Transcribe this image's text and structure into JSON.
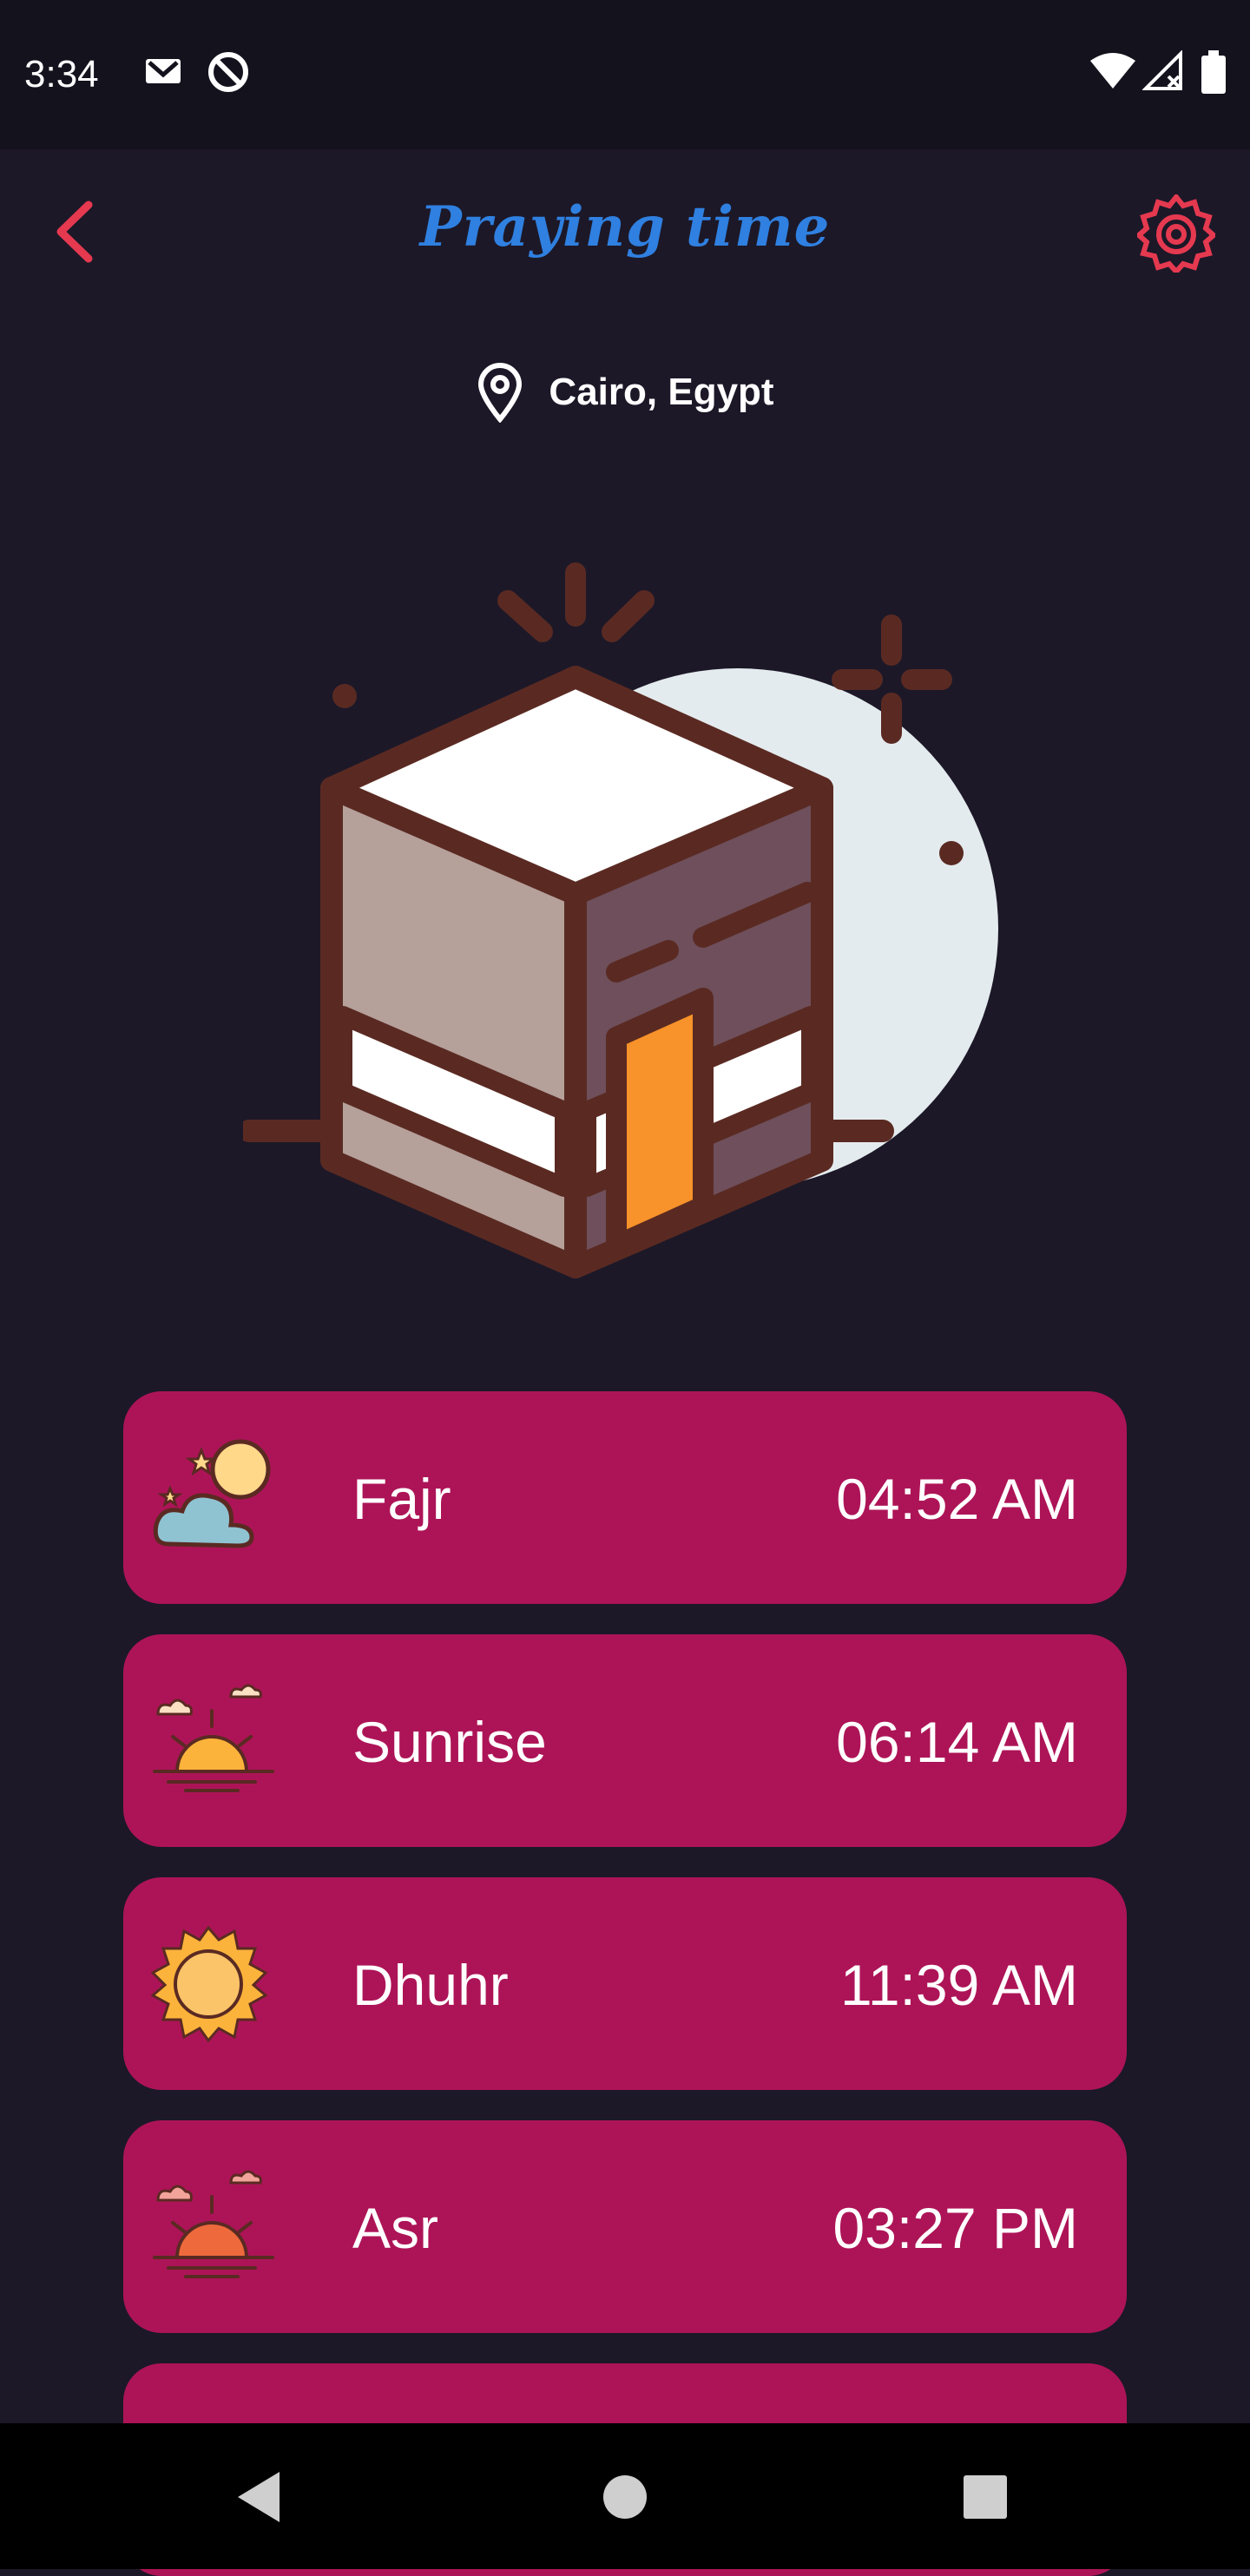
{
  "status_bar": {
    "time": "3:34",
    "icons": [
      "gmail-icon",
      "no-disturb-icon",
      "wifi-icon",
      "signal-icon",
      "battery-icon"
    ]
  },
  "app_bar": {
    "title": "Praying time",
    "back_icon": "chevron-left-icon",
    "settings_icon": "gear-icon",
    "accent_color": "#e53950",
    "title_color": "#2f80e0"
  },
  "location": {
    "icon": "map-pin-icon",
    "label": "Cairo, Egypt"
  },
  "hero": {
    "image": "kaaba-illustration"
  },
  "prayers": [
    {
      "name": "Fajr",
      "time": "04:52 AM",
      "icon": "moon-cloud-icon"
    },
    {
      "name": "Sunrise",
      "time": "06:14 AM",
      "icon": "sunrise-icon"
    },
    {
      "name": "Dhuhr",
      "time": "11:39 AM",
      "icon": "sun-icon"
    },
    {
      "name": "Asr",
      "time": "03:27 PM",
      "icon": "sunset-icon"
    },
    {
      "name": "",
      "time": "",
      "icon": "sun-icon"
    }
  ],
  "card_color": "#ad1457",
  "nav_bar": {
    "icons": [
      "back-triangle-icon",
      "home-circle-icon",
      "recents-square-icon"
    ]
  }
}
